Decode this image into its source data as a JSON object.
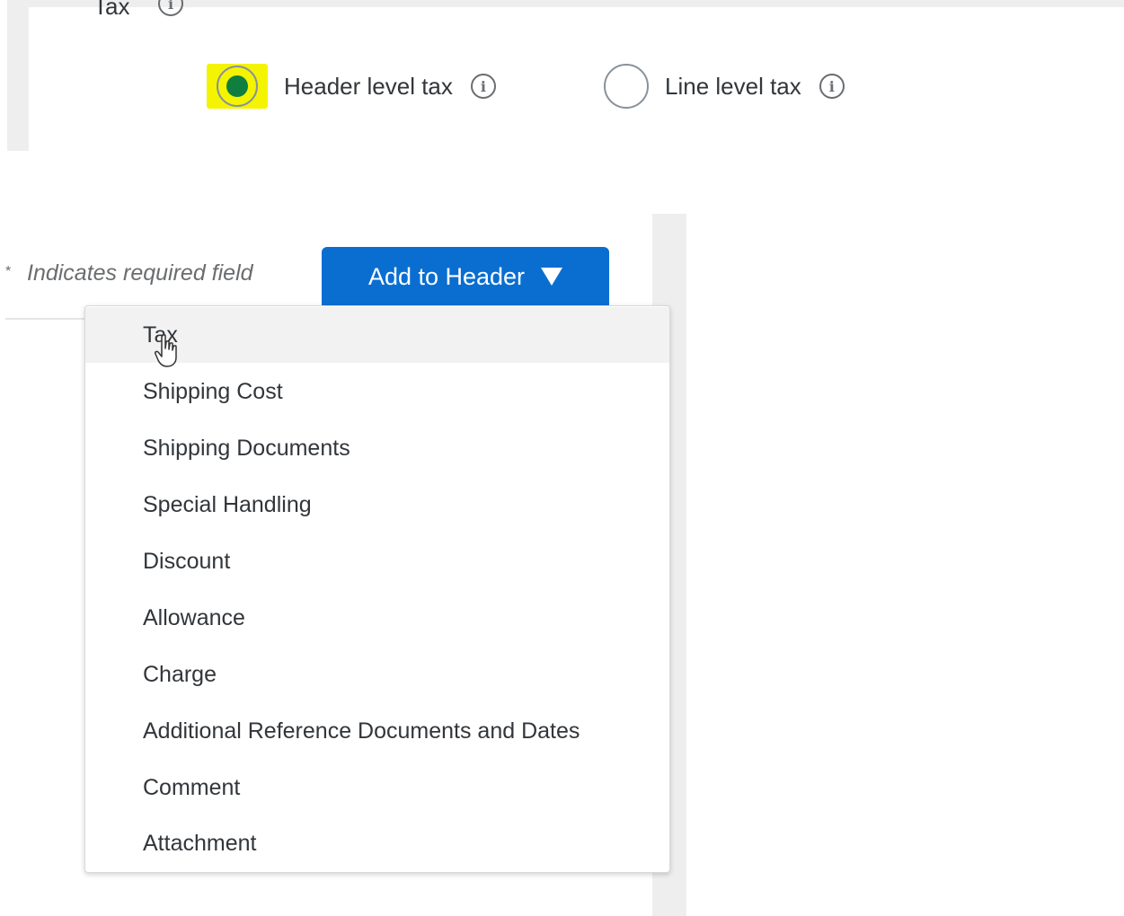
{
  "tax_section": {
    "label": "Tax",
    "options": [
      {
        "label": "Header level tax",
        "selected": true
      },
      {
        "label": "Line level tax",
        "selected": false
      }
    ]
  },
  "form": {
    "required_marker": "*",
    "required_text": "Indicates required field"
  },
  "add_to_header": {
    "label": "Add to Header",
    "menu_items": [
      "Tax",
      "Shipping Cost",
      "Shipping Documents",
      "Special Handling",
      "Discount",
      "Allowance",
      "Charge",
      "Additional Reference Documents and Dates",
      "Comment",
      "Attachment"
    ],
    "hovered_item": "Tax"
  },
  "colors": {
    "primary_button": "#0a6ed1",
    "radio_selected": "#107e3e",
    "highlight": "#f4f400"
  },
  "icons": {
    "info": "info-icon",
    "caret": "caret-down-icon",
    "cursor": "hand-pointer-icon"
  }
}
